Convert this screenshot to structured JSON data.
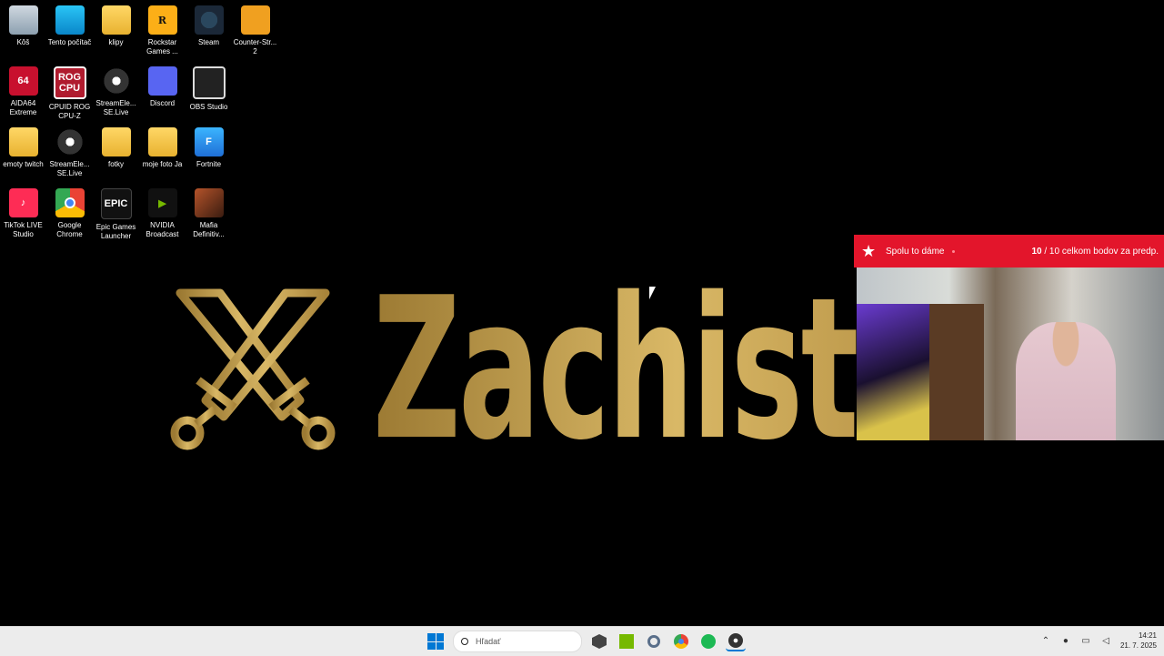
{
  "desktop": {
    "icons": [
      {
        "label": "Kôš",
        "icon": "recycle-bin-icon"
      },
      {
        "label": "Tento počítač",
        "icon": "this-pc-icon"
      },
      {
        "label": "klipy",
        "icon": "folder-icon"
      },
      {
        "label": "Rockstar Games ...",
        "icon": "rockstar-icon"
      },
      {
        "label": "Steam",
        "icon": "steam-icon"
      },
      {
        "label": "Counter-Str... 2",
        "icon": "counter-strike-icon"
      },
      {
        "label": "AIDA64 Extreme",
        "icon": "aida64-icon"
      },
      {
        "label": "CPUID ROG CPU-Z",
        "icon": "cpuz-icon"
      },
      {
        "label": "StreamEle... SE.Live",
        "icon": "streamelements-icon"
      },
      {
        "label": "Discord",
        "icon": "discord-icon"
      },
      {
        "label": "OBS Studio",
        "icon": "obs-icon"
      },
      {
        "label": "emoty twitch",
        "icon": "folder-icon"
      },
      {
        "label": "StreamEle... SE.Live",
        "icon": "streamelements-icon"
      },
      {
        "label": "fotky",
        "icon": "folder-icon"
      },
      {
        "label": "moje foto Ja",
        "icon": "folder-icon"
      },
      {
        "label": "Fortnite",
        "icon": "fortnite-icon"
      },
      {
        "label": "TikTok LIVE Studio",
        "icon": "tiktok-icon"
      },
      {
        "label": "Google Chrome",
        "icon": "chrome-icon"
      },
      {
        "label": "Epic Games Launcher",
        "icon": "epic-games-icon"
      },
      {
        "label": "NVIDIA Broadcast",
        "icon": "nvidia-broadcast-icon"
      },
      {
        "label": "Mafia Definitiv...",
        "icon": "mafia-icon"
      }
    ],
    "icon_glyphs": {
      "rockstar": "R",
      "aida": "64",
      "cpuz": "ROG CPU",
      "fortnite": "F",
      "tiktok": "♪",
      "epic": "EPIC",
      "nvidia": "▶"
    }
  },
  "banner": {
    "text": "Zachista."
  },
  "overlay": {
    "goal_title": "Spolu to dáme",
    "goal_current": "10",
    "goal_rest": " / 10 celkom bodov za predp.",
    "accent_color": "#e3152b"
  },
  "taskbar": {
    "search_placeholder": "Hľadať",
    "apps": [
      "cube-app-icon",
      "nvidia-app-icon",
      "settings-app-icon",
      "chrome-app-icon",
      "spotify-app-icon",
      "streamelements-app-icon"
    ],
    "time": "14:21",
    "date": "21. 7. 2025"
  }
}
